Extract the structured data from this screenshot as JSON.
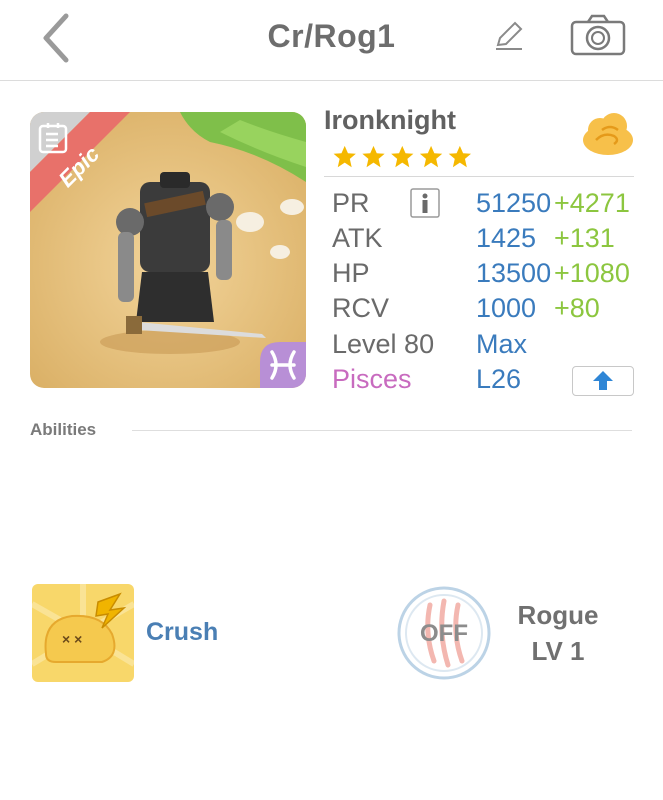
{
  "header": {
    "title": "Cr/Rog1",
    "back_icon": "chevron-left-icon",
    "edit_icon": "pencil-icon",
    "camera_icon": "camera-icon"
  },
  "card": {
    "rarity": "Epic",
    "name": "Ironknight",
    "stars": 5,
    "zodiac_icon": "pisces-icon",
    "element_icon": "cloud-icon"
  },
  "stats": {
    "pr": {
      "label": "PR",
      "value": "51250",
      "bonus": "+4271"
    },
    "atk": {
      "label": "ATK",
      "value": "1425",
      "bonus": "+131"
    },
    "hp": {
      "label": "HP",
      "value": "13500",
      "bonus": "+1080"
    },
    "rcv": {
      "label": "RCV",
      "value": "1000",
      "bonus": "+80"
    },
    "level": {
      "label": "Level 80",
      "value": "Max"
    },
    "sign": {
      "label": "Pisces",
      "value": "L26"
    }
  },
  "abilities": {
    "header": "Abilities",
    "skill_name": "Crush",
    "toggle_label": "OFF",
    "class_name": "Rogue",
    "class_level": "LV 1"
  },
  "colors": {
    "stat_value": "#3a7bbd",
    "stat_bonus": "#8cc63f",
    "sign_label": "#c86bbf",
    "epic_banner": "#e8716a"
  }
}
